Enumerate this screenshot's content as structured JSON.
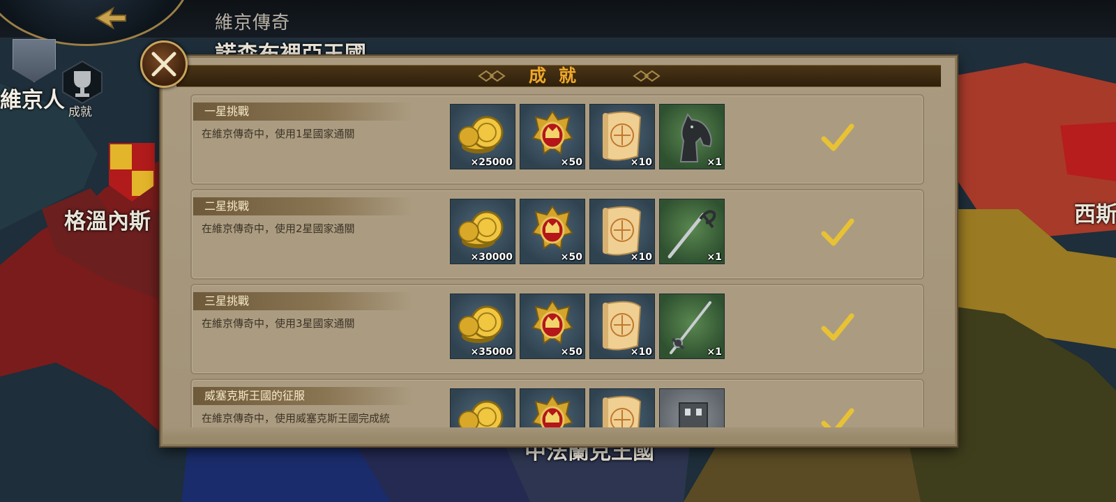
{
  "topbar": {
    "title": "維京傳奇",
    "back_icon": "back-arrow-icon"
  },
  "left_panel": {
    "faction_name": "維京人",
    "achievement_label": "成就"
  },
  "map_labels": {
    "north_kingdom": "諾森布裡亞王國",
    "west_kingdom": "格溫內斯",
    "east_kingdom": "西斯",
    "south_kingdom": "中法蘭克王國"
  },
  "dialog": {
    "title": "成就",
    "close_icon": "close-icon",
    "achievements": [
      {
        "title": "一星挑戰",
        "description": "在維京傳奇中，使用1星國家通關",
        "completed": true,
        "rewards": [
          {
            "icon": "gold-coins-icon",
            "qty": "×25000",
            "bg": "blue"
          },
          {
            "icon": "royal-crest-icon",
            "qty": "×50",
            "bg": "blue"
          },
          {
            "icon": "scroll-map-icon",
            "qty": "×10",
            "bg": "blue"
          },
          {
            "icon": "horse-icon",
            "qty": "×1",
            "bg": "green"
          }
        ]
      },
      {
        "title": "二星挑戰",
        "description": "在維京傳奇中，使用2星國家通關",
        "completed": true,
        "rewards": [
          {
            "icon": "gold-coins-icon",
            "qty": "×30000",
            "bg": "blue"
          },
          {
            "icon": "royal-crest-icon",
            "qty": "×50",
            "bg": "blue"
          },
          {
            "icon": "scroll-map-icon",
            "qty": "×10",
            "bg": "blue"
          },
          {
            "icon": "sabre-icon",
            "qty": "×1",
            "bg": "green"
          }
        ]
      },
      {
        "title": "三星挑戰",
        "description": "在維京傳奇中，使用3星國家通關",
        "completed": true,
        "rewards": [
          {
            "icon": "gold-coins-icon",
            "qty": "×35000",
            "bg": "blue"
          },
          {
            "icon": "royal-crest-icon",
            "qty": "×50",
            "bg": "blue"
          },
          {
            "icon": "scroll-map-icon",
            "qty": "×10",
            "bg": "blue"
          },
          {
            "icon": "rapier-icon",
            "qty": "×1",
            "bg": "green"
          }
        ]
      },
      {
        "title": "威塞克斯王國的征服",
        "description": "在維京傳奇中，使用威塞克斯王國完成統",
        "completed": true,
        "rewards": [
          {
            "icon": "gold-coins-icon",
            "qty": "",
            "bg": "blue"
          },
          {
            "icon": "royal-crest-icon",
            "qty": "",
            "bg": "blue"
          },
          {
            "icon": "scroll-map-icon",
            "qty": "",
            "bg": "blue"
          },
          {
            "icon": "building-icon",
            "qty": "",
            "bg": "grey"
          }
        ]
      }
    ]
  },
  "colors": {
    "dialog_bg": "#a89a7f",
    "title_gold": "#f0a828",
    "check_gold": "#e8c234"
  }
}
